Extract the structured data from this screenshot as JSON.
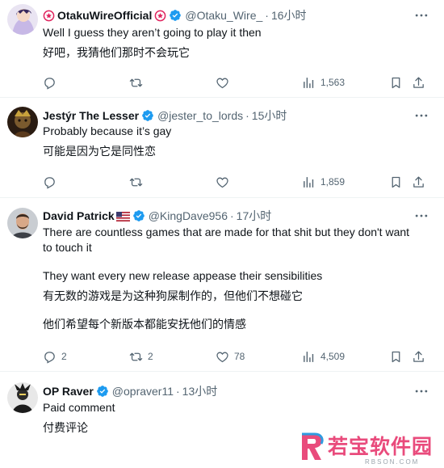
{
  "tweets": [
    {
      "name": "OtakuWireOfficial",
      "handle": "@Otaku_Wire_",
      "time": "16小时",
      "lines": [
        "Well I guess they aren’t going to play it then",
        "好吧，我猜他们那时不会玩它"
      ],
      "replies": "",
      "retweets": "",
      "likes": "",
      "views": "1,563"
    },
    {
      "name": "Jestýr The Lesser",
      "handle": "@jester_to_lords",
      "time": "15小时",
      "lines": [
        "Probably because it’s gay",
        "可能是因为它是同性恋"
      ],
      "replies": "",
      "retweets": "",
      "likes": "",
      "views": "1,859"
    },
    {
      "name": "David Patrick",
      "handle": "@KingDave956",
      "time": "17小时",
      "lines": [
        "There are countless games that are made for that shit but they don't want",
        "to touch it",
        "They want every new release appease their sensibilities",
        "有无数的游戏是为这种狗屎制作的，但他们不想碰它",
        "他们希望每个新版本都能安抚他们的情感"
      ],
      "replies": "2",
      "retweets": "2",
      "likes": "78",
      "views": "4,509"
    },
    {
      "name": "OP Raver",
      "handle": "@opraver11",
      "time": "13小时",
      "lines": [
        "Paid comment",
        "付费评论"
      ]
    }
  ],
  "watermark": {
    "brand": "若宝软件园",
    "url": "RBSON.COM"
  },
  "colors": {
    "verified": "#1d9bf0",
    "icon_gray": "#536471",
    "divider": "#eff3f4"
  },
  "icons": [
    "reply-icon",
    "retweet-icon",
    "like-icon",
    "views-icon",
    "bookmark-icon",
    "share-icon",
    "more-icon",
    "verified-icon"
  ]
}
